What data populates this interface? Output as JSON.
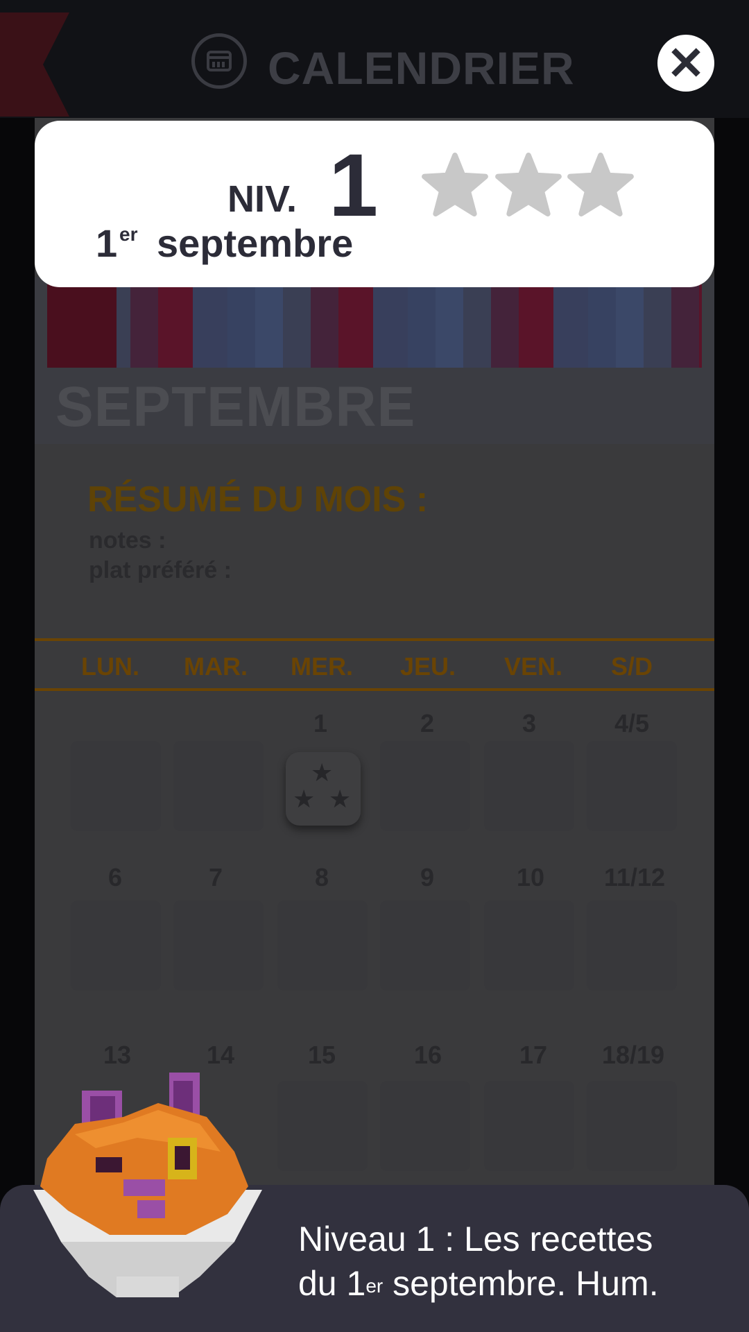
{
  "header": {
    "title": "CALENDRIER",
    "calendar_icon": "calendar-icon",
    "close_icon": "close-icon",
    "close_symbol": "✕"
  },
  "level_card": {
    "level_prefix": "NIV.",
    "level_number": "1",
    "date_day": "1",
    "date_suffix": "er",
    "date_month": "septembre",
    "stars_earned": 0,
    "stars_total": 3,
    "star_color_empty": "#c8c8c8"
  },
  "calendar": {
    "month": "SEPTEMBRE",
    "summary_title": "RÉSUMÉ DU MOIS :",
    "notes_label": "notes :",
    "favorite_label": "plat préféré :",
    "weekdays": [
      "LUN.",
      "MAR.",
      "MER.",
      "JEU.",
      "VEN.",
      "S/D"
    ],
    "weeks": [
      [
        "",
        "",
        "1",
        "2",
        "3",
        "4/5"
      ],
      [
        "6",
        "7",
        "8",
        "9",
        "10",
        "11/12"
      ],
      [
        "13",
        "14",
        "15",
        "16",
        "17",
        "18/19"
      ]
    ]
  },
  "dialog": {
    "line1": "Niveau 1 : Les recettes",
    "line2_prefix": "du 1",
    "line2_sup": "er",
    "line2_suffix": " septembre. Hum."
  },
  "colors": {
    "accent_gold": "#e5a30e",
    "dialog_bg": "#32313e"
  }
}
